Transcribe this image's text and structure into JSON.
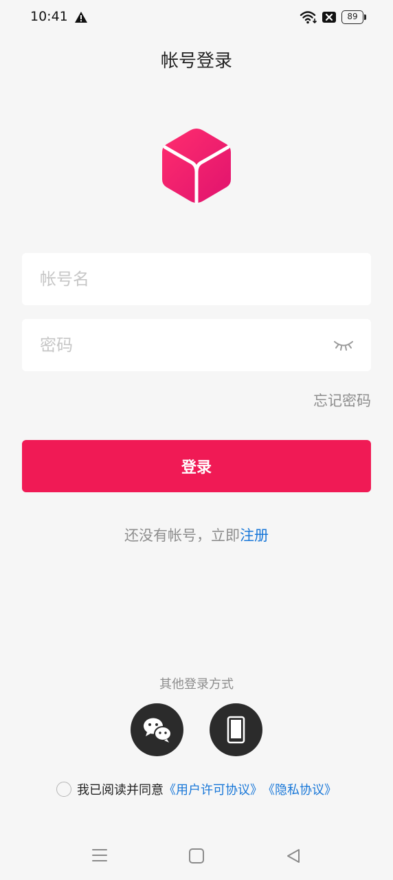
{
  "status_bar": {
    "time": "10:41",
    "battery_level": "89",
    "icons": [
      "warning-icon",
      "wifi-icon",
      "no-sim-icon",
      "battery-icon"
    ]
  },
  "header": {
    "title": "帐号登录"
  },
  "form": {
    "account_placeholder": "帐号名",
    "account_value": "",
    "password_placeholder": "密码",
    "password_value": "",
    "forgot_label": "忘记密码",
    "login_label": "登录"
  },
  "register": {
    "prompt": "还没有帐号，立即",
    "link": "注册"
  },
  "other_login": {
    "label": "其他登录方式",
    "methods": [
      "wechat-icon",
      "phone-icon"
    ]
  },
  "agreement": {
    "text": "我已阅读并同意",
    "user_license": "《用户许可协议》",
    "privacy": "《隐私协议》"
  },
  "colors": {
    "accent": "#f01a55",
    "link": "#1877d8",
    "background": "#f6f6f6",
    "social_bg": "#2b2b2b"
  }
}
